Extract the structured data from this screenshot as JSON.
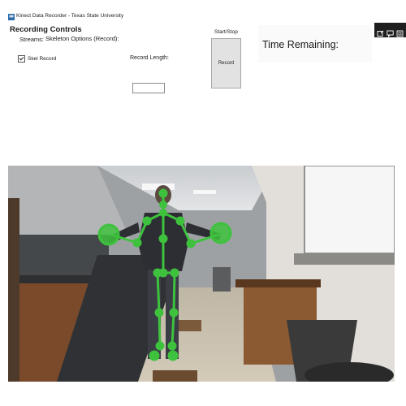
{
  "window": {
    "title": "Kinect Data Recorder - Texas State University",
    "app_icon": "kinect-app-icon"
  },
  "controls": {
    "heading": "Recording Controls",
    "streams_label": "Streams:",
    "streams_value": "Skeleton Options (Record):",
    "skel_record_label": "Skel Record",
    "skel_record_checked": true,
    "record_length_label": "Record Length:",
    "record_length_value": ""
  },
  "start_stop": {
    "label": "Start/Stop",
    "button_label": "Record"
  },
  "time": {
    "label": "Time Remaining:"
  },
  "toolbar": {
    "icons": [
      "screen-capture-icon",
      "feedback-icon",
      "window-icon"
    ],
    "bg_color": "#1f1f1f"
  },
  "camera_view": {
    "type": "kinect-color-feed-with-skeleton-overlay",
    "skeleton_color": "#3ec23e"
  }
}
